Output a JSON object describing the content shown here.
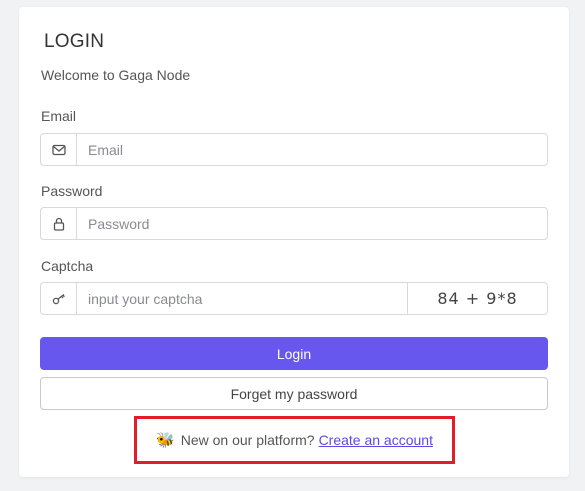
{
  "card": {
    "title": "LOGIN",
    "subtitle": "Welcome to Gaga Node"
  },
  "email": {
    "label": "Email",
    "placeholder": "Email",
    "icon": "mail-icon"
  },
  "password": {
    "label": "Password",
    "placeholder": "Password",
    "icon": "lock-icon"
  },
  "captcha": {
    "label": "Captcha",
    "placeholder": "input your captcha",
    "icon": "key-icon",
    "challenge": "84 + 9*8"
  },
  "buttons": {
    "login": "Login",
    "forgot": "Forget my password"
  },
  "signup": {
    "emoji": "🐝",
    "text": "New on our platform?",
    "link": "Create an account"
  },
  "colors": {
    "primary": "#6757ee",
    "highlight_border": "#e11d2a",
    "link": "#5b4ae6"
  }
}
